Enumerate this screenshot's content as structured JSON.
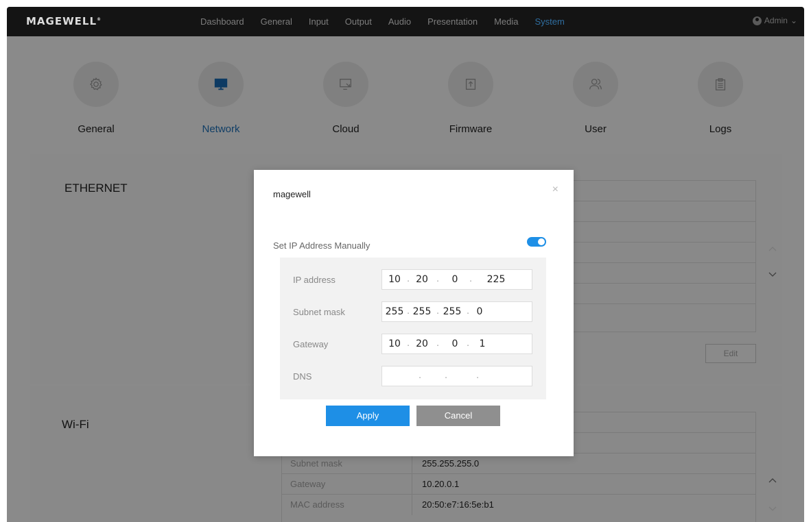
{
  "brand": {
    "logo": "MAGEWELL",
    "mark": "®"
  },
  "nav": [
    "Dashboard",
    "General",
    "Input",
    "Output",
    "Audio",
    "Presentation",
    "Media",
    "System"
  ],
  "nav_active": "System",
  "user": {
    "name": "Admin",
    "caret": "⌄"
  },
  "system_tabs": [
    {
      "label": "General",
      "icon": "gear-icon"
    },
    {
      "label": "Network",
      "icon": "monitor-icon"
    },
    {
      "label": "Cloud",
      "icon": "cloud-screen-icon"
    },
    {
      "label": "Firmware",
      "icon": "upload-icon"
    },
    {
      "label": "User",
      "icon": "users-icon"
    },
    {
      "label": "Logs",
      "icon": "clipboard-icon"
    }
  ],
  "active_tab": "Network",
  "ethernet": {
    "title": "ETHERNET",
    "edit": "Edit"
  },
  "wifi": {
    "title": "Wi-Fi",
    "rows": [
      {
        "key": "Subnet mask",
        "value": "255.255.255.0"
      },
      {
        "key": "Gateway",
        "value": "10.20.0.1"
      },
      {
        "key": "MAC address",
        "value": "20:50:e7:16:5e:b1"
      }
    ]
  },
  "modal": {
    "title": "magewell",
    "close": "×",
    "manual_label": "Set IP Address Manually",
    "manual_enabled": true,
    "fields": [
      {
        "label": "IP address",
        "octets": [
          "10",
          "20",
          "0",
          "225"
        ]
      },
      {
        "label": "Subnet mask",
        "octets": [
          "255",
          "255",
          "255",
          "0"
        ]
      },
      {
        "label": "Gateway",
        "octets": [
          "10",
          "20",
          "0",
          "1"
        ]
      },
      {
        "label": "DNS",
        "octets": [
          "",
          "",
          "",
          ""
        ]
      }
    ],
    "apply": "Apply",
    "cancel": "Cancel"
  },
  "colors": {
    "accent": "#1e8fe6",
    "overlay": "#8a8a8a",
    "topbar": "#141414"
  }
}
